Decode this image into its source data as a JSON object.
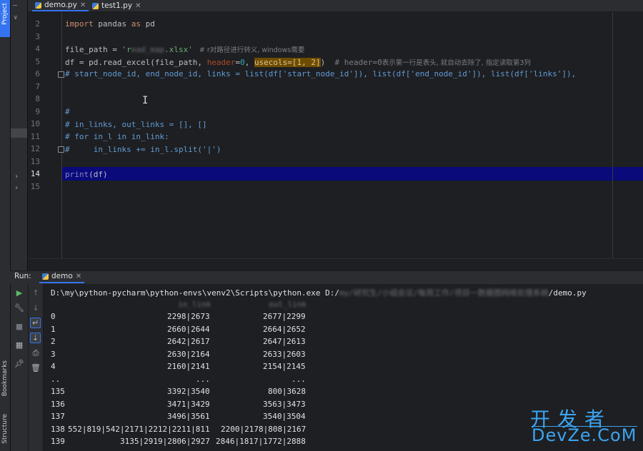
{
  "left_strip": {
    "project_label": "Project",
    "bookmarks_label": "Bookmarks",
    "structure_label": "Structure"
  },
  "tabs": [
    {
      "label": "demo.py",
      "active": true
    },
    {
      "label": "test1.py",
      "active": false
    }
  ],
  "editor": {
    "line_numbers": [
      "2",
      "3",
      "4",
      "5",
      "6",
      "7",
      "8",
      "9",
      "10",
      "11",
      "12",
      "13",
      "14",
      "15"
    ],
    "current_line": "14",
    "lines": {
      "l2": {
        "kw": "import",
        "mod": " pandas ",
        "as": "as",
        "alias": " pd"
      },
      "l4": {
        "a": "file_path = ",
        "s1": "'r",
        "s2": "ead_map",
        "s3": ".xlsx'",
        "c": "   # r对路径进行转义, windows需要"
      },
      "l5": {
        "a": "df = pd.read_excel(file_path, ",
        "p1": "header",
        "b": "=",
        "n0": "0",
        "c2": ", ",
        "u": "usecols=[1, 2]",
        "d": ")  ",
        "cmt1": "# header=0",
        "cmt2": "表示第一行是表头, 就自动去除了, 指定读取第3列"
      },
      "l6": "# start_node_id, end_node_id, links = list(df['start_node_id']), list(df['end_node_id']), list(df['links']),",
      "l9": "#",
      "l10": "# in_links, out_links = [], []",
      "l11": "# for in_l in in_link:",
      "l12": "#     in_links += in_l.split('|')",
      "l14a": "print",
      "l14b": "(df)"
    }
  },
  "run": {
    "label": "Run:",
    "tab_label": "demo",
    "command_prefix": "D:\\my\\python-pycharm\\python-envs\\venv2\\Scripts\\python.exe D:/",
    "command_blur": "my/研究生/小组会议/每周工作/项目一数据图网络处理系统",
    "command_suffix": "/demo.py",
    "header_in": "in_link",
    "header_out": "out_link",
    "rows": [
      {
        "idx": "0",
        "in": "2298|2673",
        "out": "2677|2299"
      },
      {
        "idx": "1",
        "in": "2660|2644",
        "out": "2664|2652"
      },
      {
        "idx": "2",
        "in": "2642|2617",
        "out": "2647|2613"
      },
      {
        "idx": "3",
        "in": "2630|2164",
        "out": "2633|2603"
      },
      {
        "idx": "4",
        "in": "2160|2141",
        "out": "2154|2145"
      },
      {
        "idx": "..",
        "in": "...",
        "out": "..."
      },
      {
        "idx": "135",
        "in": "3392|3540",
        "out": "800|3628"
      },
      {
        "idx": "136",
        "in": "3471|3429",
        "out": "3563|3473"
      },
      {
        "idx": "137",
        "in": "3496|3561",
        "out": "3540|3504"
      },
      {
        "idx": "138",
        "in": "552|819|542|2171|2212|2211|811",
        "out": "2200|2178|808|2167"
      },
      {
        "idx": "139",
        "in": "3135|2919|2806|2927",
        "out": "2846|1817|1772|2888"
      }
    ]
  },
  "watermark": {
    "top": "开发者",
    "bottom": "DevZe.CoM"
  },
  "colors": {
    "accent": "#3574f0",
    "current_line": "#0a0a7a",
    "watermark": "#3ba4f2"
  }
}
